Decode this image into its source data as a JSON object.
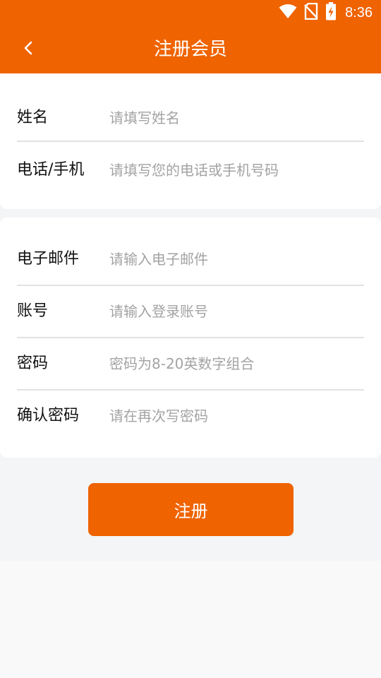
{
  "status_bar": {
    "time": "8:36",
    "icons": [
      "wifi-icon",
      "no-sim-icon",
      "battery-charging-icon"
    ]
  },
  "header": {
    "title": "注册会员",
    "back_icon": "chevron-left-icon",
    "background_color": "#ef6300"
  },
  "form": {
    "section_1": [
      {
        "label": "姓名",
        "placeholder": "请填写姓名",
        "value": ""
      },
      {
        "label": "电话/手机",
        "placeholder": "请填写您的电话或手机号码",
        "value": ""
      }
    ],
    "section_2": [
      {
        "label": "电子邮件",
        "placeholder": "请输入电子邮件",
        "value": ""
      },
      {
        "label": "账号",
        "placeholder": "请输入登录账号",
        "value": ""
      },
      {
        "label": "密码",
        "placeholder": "密码为8-20英数字组合",
        "value": ""
      },
      {
        "label": "确认密码",
        "placeholder": "请在再次写密码",
        "value": ""
      }
    ]
  },
  "submit": {
    "label": "注册",
    "color": "#ef6300"
  }
}
